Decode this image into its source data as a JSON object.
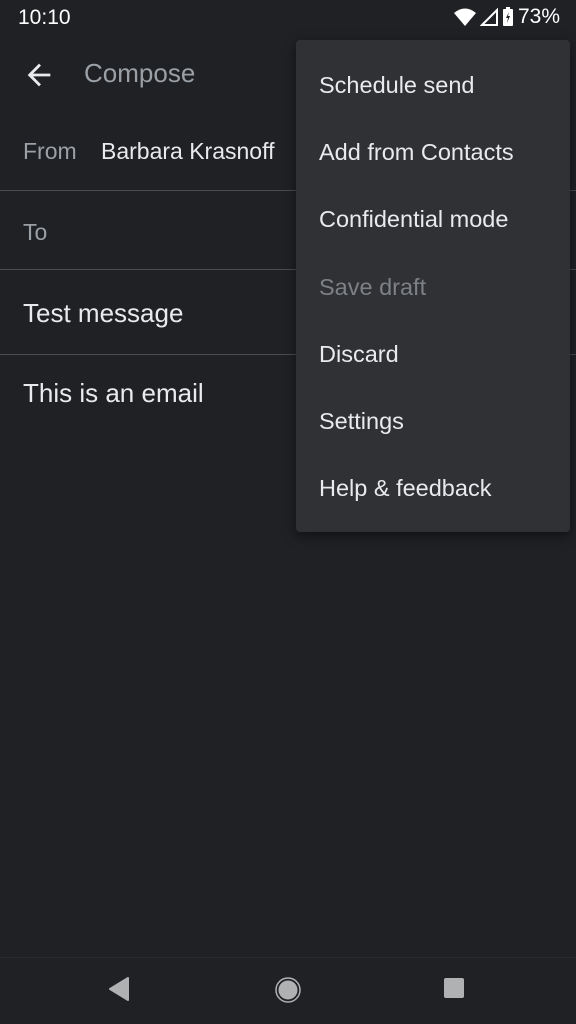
{
  "status_bar": {
    "time": "10:10",
    "battery": "73%",
    "icons": [
      "wifi-icon",
      "cellular-signal-icon",
      "battery-charging-icon"
    ]
  },
  "header": {
    "title": "Compose",
    "back_icon": "arrow-left-icon"
  },
  "compose": {
    "from_label": "From",
    "from_value": "Barbara Krasnoff",
    "to_label": "To",
    "subject": "Test message",
    "body": "This is an email"
  },
  "menu": {
    "items": [
      {
        "label": "Schedule send",
        "enabled": true
      },
      {
        "label": "Add from Contacts",
        "enabled": true
      },
      {
        "label": "Confidential mode",
        "enabled": true
      },
      {
        "label": "Save draft",
        "enabled": false
      },
      {
        "label": "Discard",
        "enabled": true
      },
      {
        "label": "Settings",
        "enabled": true
      },
      {
        "label": "Help & feedback",
        "enabled": true
      }
    ]
  },
  "nav_bar": {
    "icons": [
      "nav-back-icon",
      "nav-home-icon",
      "nav-recents-icon"
    ]
  },
  "colors": {
    "background": "#202124",
    "menu": "#303134",
    "text": "#e8eaed",
    "muted": "#9aa0a6"
  }
}
